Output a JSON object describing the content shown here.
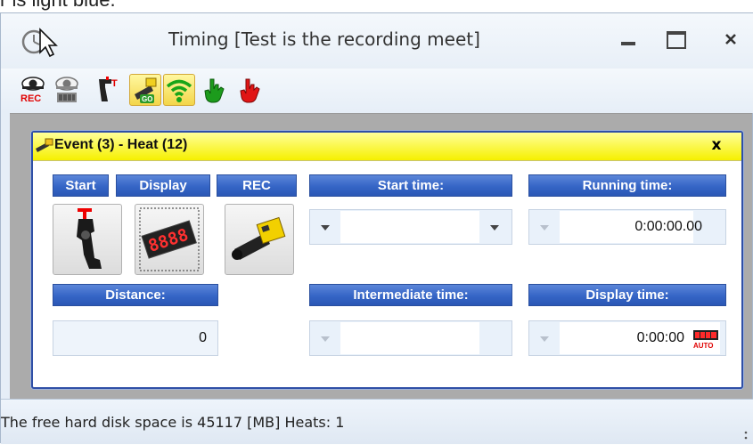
{
  "caption": {
    "text": "r is light blue."
  },
  "window": {
    "title": "Timing [Test is the recording meet]",
    "controls": {
      "minimize": "minimize-icon",
      "maximize": "maximize-icon",
      "close": "close-icon"
    }
  },
  "toolbar": {
    "buttons": [
      {
        "name": "rec-eye-icon",
        "active": false
      },
      {
        "name": "display-eye-icon",
        "active": false
      },
      {
        "name": "start-gun-icon",
        "active": false
      },
      {
        "name": "camera-go-icon",
        "active": true
      },
      {
        "name": "wifi-icon",
        "active": true
      },
      {
        "name": "green-hand-icon",
        "active": false
      },
      {
        "name": "red-hand-icon",
        "active": false
      }
    ]
  },
  "event": {
    "title": "Event (3) - Heat (12)",
    "close_label": "x",
    "headers": {
      "start": "Start",
      "display": "Display",
      "rec": "REC",
      "start_time": "Start time:",
      "running_time": "Running time:",
      "distance": "Distance:",
      "intermediate_time": "Intermediate time:",
      "display_time": "Display time:"
    },
    "fields": {
      "start_time": "",
      "running_time": "0:00:00.00",
      "distance": "0",
      "intermediate_time": "",
      "display_time": "0:00:00"
    },
    "display_icon_text": "8888",
    "auto_badge": "AUTO"
  },
  "status": {
    "text": "The free hard disk space is 45117 [MB]  Heats: 1"
  },
  "colors": {
    "header_blue": "#3565c6",
    "title_yellow": "#f6f000",
    "workspace_gray": "#ababab",
    "frame_blue": "#2f4fa6"
  }
}
